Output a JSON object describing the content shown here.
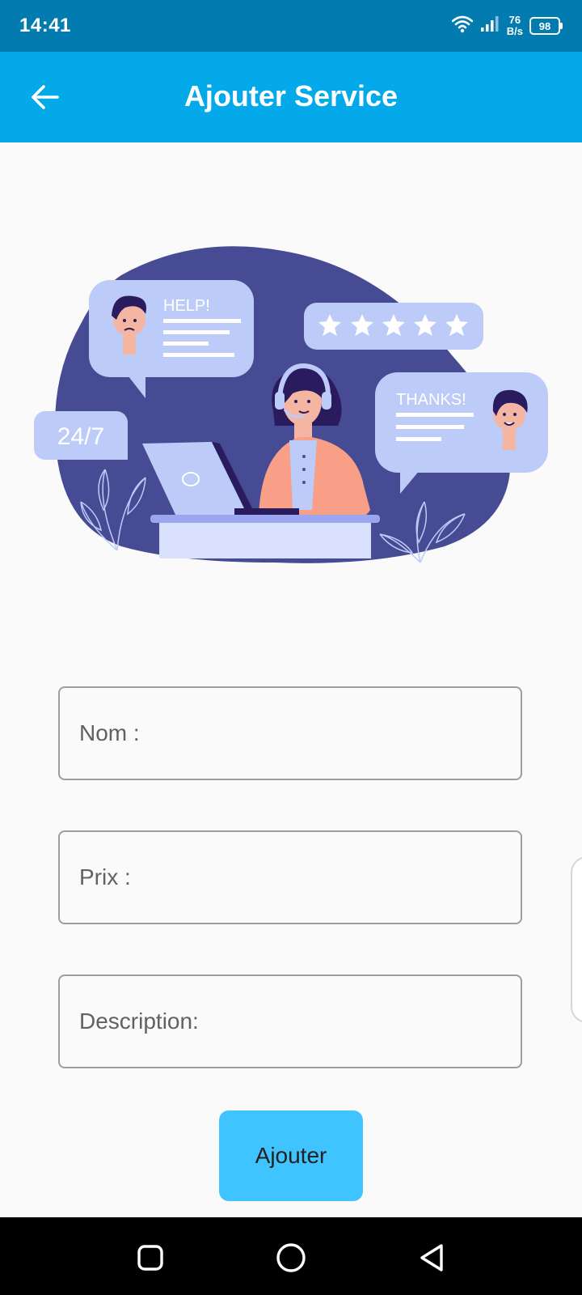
{
  "status_bar": {
    "time": "14:41",
    "net_speed_value": "76",
    "net_speed_unit": "B/s",
    "battery": "98"
  },
  "app_bar": {
    "title": "Ajouter Service"
  },
  "illustration": {
    "help_text": "HELP!",
    "thanks_text": "THANKS!",
    "availability_text": "24/7",
    "rating_stars": 5
  },
  "form": {
    "name_placeholder": "Nom :",
    "price_placeholder": "Prix :",
    "description_placeholder": "Description:",
    "submit_label": "Ajouter"
  },
  "colors": {
    "status_bar": "#027bb0",
    "app_bar": "#03a9e9",
    "button": "#40c4ff",
    "blob": "#464b93",
    "bubble": "#bccbf8"
  }
}
